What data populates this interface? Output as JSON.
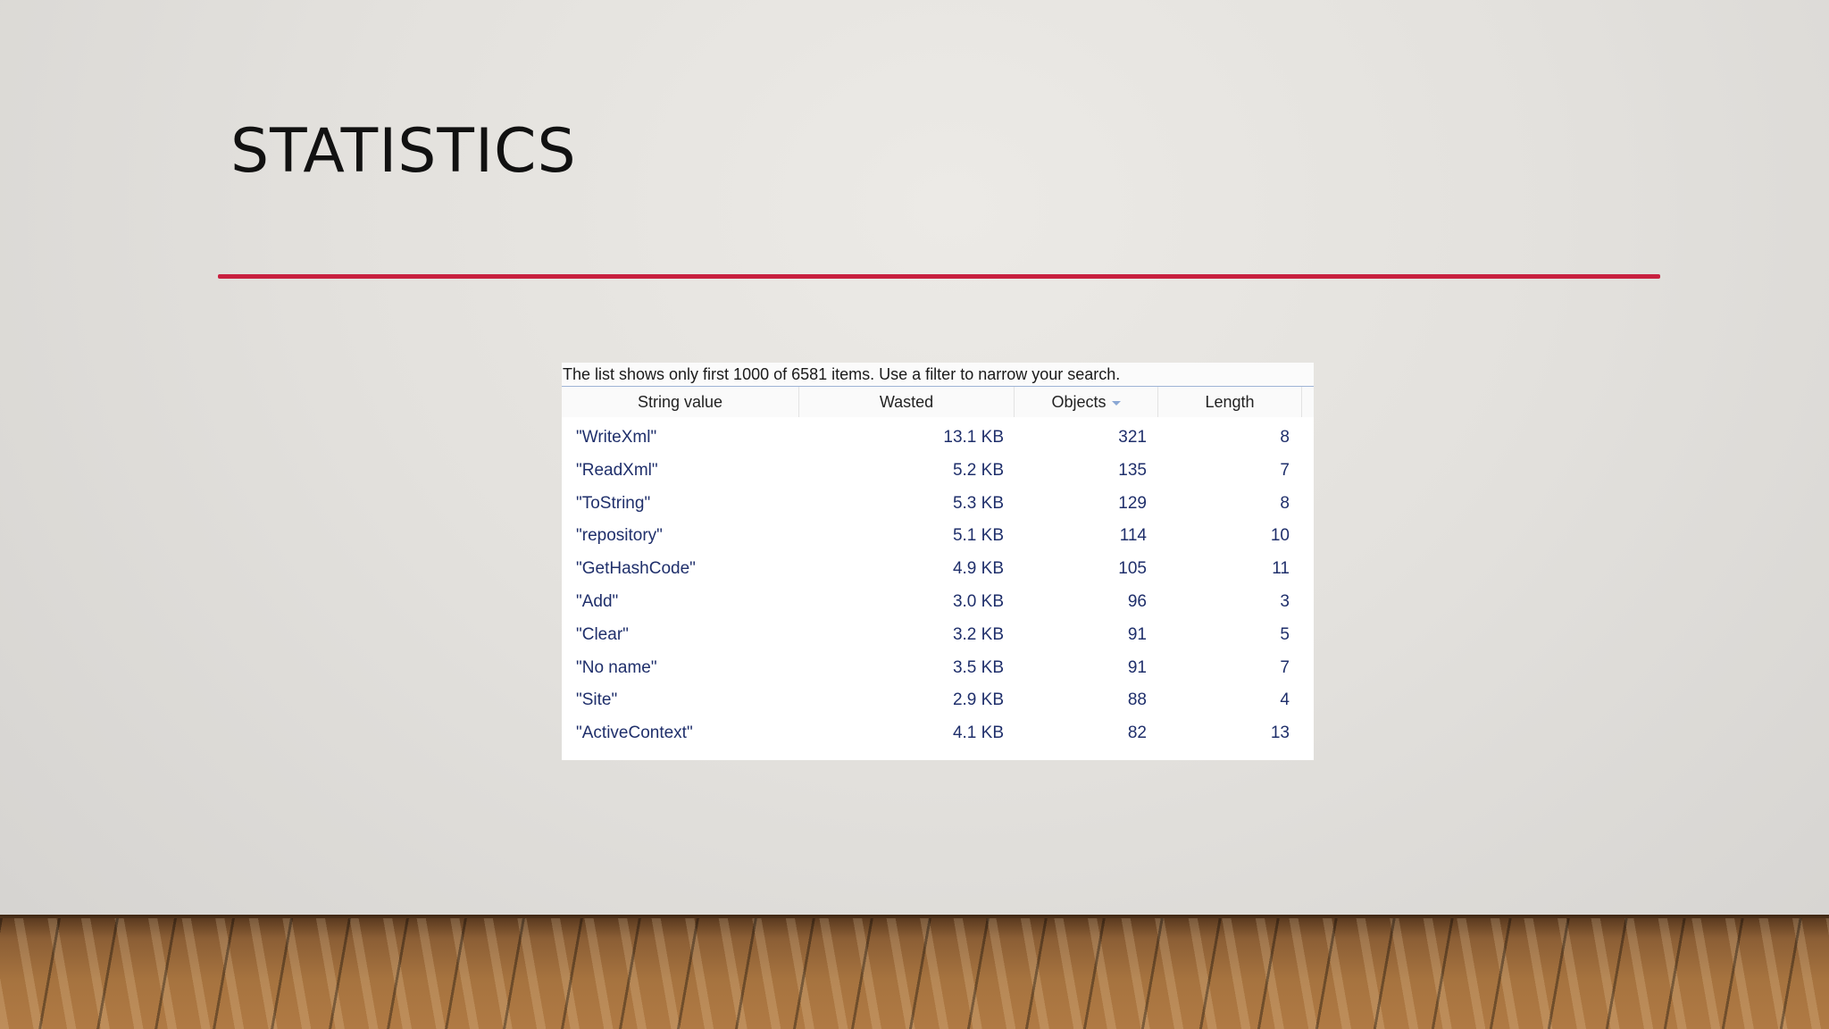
{
  "slide": {
    "title": "STATISTICS"
  },
  "table": {
    "notice": "The list shows only first 1000 of 6581 items. Use a filter to narrow your search.",
    "columns": {
      "string_value": "String value",
      "wasted": "Wasted",
      "objects": "Objects",
      "length": "Length"
    },
    "rows": [
      {
        "name": "\"WriteXml\"",
        "wasted": "13.1 KB",
        "objects": "321",
        "length": "8"
      },
      {
        "name": "\"ReadXml\"",
        "wasted": "5.2 KB",
        "objects": "135",
        "length": "7"
      },
      {
        "name": "\"ToString\"",
        "wasted": "5.3 KB",
        "objects": "129",
        "length": "8"
      },
      {
        "name": "\"repository\"",
        "wasted": "5.1 KB",
        "objects": "114",
        "length": "10"
      },
      {
        "name": "\"GetHashCode\"",
        "wasted": "4.9 KB",
        "objects": "105",
        "length": "11"
      },
      {
        "name": "\"Add\"",
        "wasted": "3.0 KB",
        "objects": "96",
        "length": "3"
      },
      {
        "name": "\"Clear\"",
        "wasted": "3.2 KB",
        "objects": "91",
        "length": "5"
      },
      {
        "name": "\"No name\"",
        "wasted": "3.5 KB",
        "objects": "91",
        "length": "7"
      },
      {
        "name": "\"Site\"",
        "wasted": "2.9 KB",
        "objects": "88",
        "length": "4"
      },
      {
        "name": "\"ActiveContext\"",
        "wasted": "4.1 KB",
        "objects": "82",
        "length": "13"
      }
    ]
  },
  "colors": {
    "accent_rule": "#c8203f",
    "value_text": "#1f2f6b"
  }
}
